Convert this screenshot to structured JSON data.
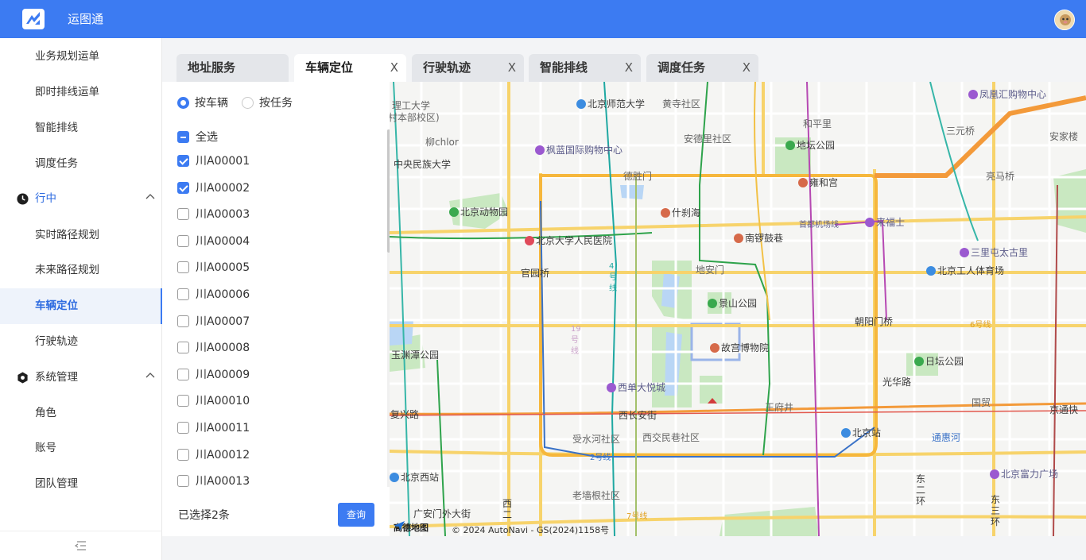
{
  "app": {
    "title": "运图通"
  },
  "sidebar": {
    "items_top": [
      "业务规划运单",
      "即时排线运单",
      "智能排线",
      "调度任务"
    ],
    "group_running": {
      "label": "行中",
      "items": [
        "实时路径规划",
        "未来路径规划",
        "车辆定位",
        "行驶轨迹"
      ]
    },
    "group_system": {
      "label": "系统管理",
      "items": [
        "角色",
        "账号",
        "团队管理"
      ]
    },
    "active_item": "车辆定位"
  },
  "tabs": [
    {
      "label": "地址服务",
      "closable": false,
      "active": false
    },
    {
      "label": "车辆定位",
      "closable": true,
      "active": true
    },
    {
      "label": "行驶轨迹",
      "closable": true,
      "active": false
    },
    {
      "label": "智能排线",
      "closable": true,
      "active": false
    },
    {
      "label": "调度任务",
      "closable": true,
      "active": false
    }
  ],
  "close_glyph": "X",
  "panel": {
    "mode_options": [
      {
        "label": "按车辆",
        "selected": true
      },
      {
        "label": "按任务",
        "selected": false
      }
    ],
    "select_all_label": "全选",
    "vehicles": [
      {
        "plate": "川A00001",
        "checked": true
      },
      {
        "plate": "川A00002",
        "checked": true
      },
      {
        "plate": "川A00003",
        "checked": false
      },
      {
        "plate": "川A00004",
        "checked": false
      },
      {
        "plate": "川A00005",
        "checked": false
      },
      {
        "plate": "川A00006",
        "checked": false
      },
      {
        "plate": "川A00007",
        "checked": false
      },
      {
        "plate": "川A00008",
        "checked": false
      },
      {
        "plate": "川A00009",
        "checked": false
      },
      {
        "plate": "川A00010",
        "checked": false
      },
      {
        "plate": "川A00011",
        "checked": false
      },
      {
        "plate": "川A00012",
        "checked": false
      },
      {
        "plate": "川A00013",
        "checked": false
      }
    ],
    "selected_count_text": "已选择2条",
    "query_button": "查询"
  },
  "map": {
    "labels": [
      "理工大学",
      "村本部校区)",
      "北京师范大学",
      "黄寺社区",
      "凤凰汇购物中心",
      "柳chlor",
      "和平里",
      "三元桥",
      "安家楼",
      "中央民族大学",
      "枫蓝国际购物中心",
      "安德里社区",
      "地坛公园",
      "德胜门",
      "雍和宫",
      "亮马桥",
      "北京动物园",
      "什刹海",
      "首都机场线",
      "来福士",
      "北京大学人民医院",
      "南锣鼓巷",
      "三里屯太古里",
      "官园桥",
      "地安门",
      "北京工人体育场",
      "景山公园",
      "朝阳门桥",
      "6号线",
      "玉渊潭公园",
      "故宫博物院",
      "日坛公园",
      "西单大悦城",
      "光华路",
      "国贸",
      "复兴路",
      "西长安街",
      "王府井",
      "北京站",
      "通惠河",
      "京通快",
      "受水河社区",
      "西交民巷社区",
      "2号线",
      "北京西站",
      "北京富力广场",
      "东二环",
      "东三环",
      "广安门外大街",
      "老墙根社区",
      "7号线",
      "4号线",
      "19号线",
      "西二"
    ],
    "logo_text": "高德地图",
    "copyright": "© 2024 AutoNavi - GS(2024)1158号"
  },
  "colors": {
    "brand": "#3c7bf2",
    "active_text": "#2f6ce0"
  }
}
